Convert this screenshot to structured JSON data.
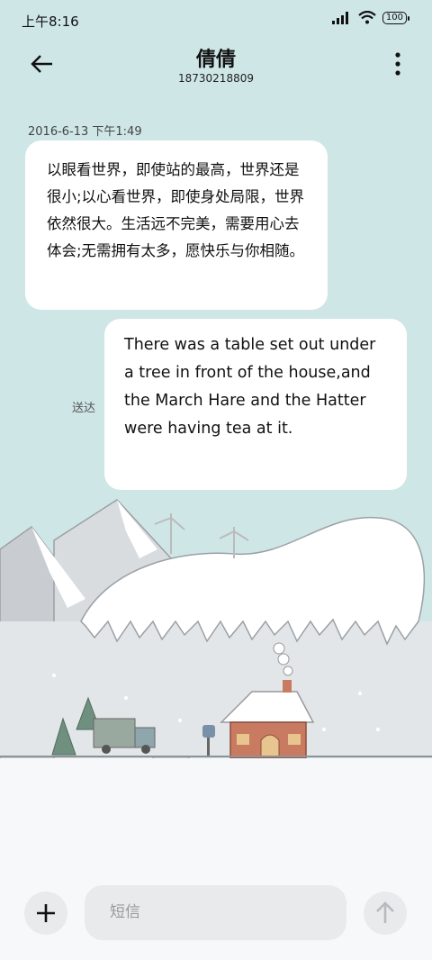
{
  "status_bar": {
    "time": "上午8:16",
    "battery": "100"
  },
  "header": {
    "contact_name": "倩倩",
    "phone_number": "18730218809"
  },
  "messages": [
    {
      "timestamp": "2016-6-13 下午1:49",
      "text": "以眼看世界，即使站的最高，世界还是很小;以心看世界，即使身处局限，世界依然很大。生活远不完美，需要用心去体会;无需拥有太多，愿快乐与你相随。"
    },
    {
      "text": "There was a table set out under a tree in front of the house,and the March Hare and the Hatter were having tea at it.",
      "status": "送达"
    }
  ],
  "composer": {
    "placeholder": "短信"
  },
  "colors": {
    "background": "#cfe6e7",
    "bubble": "#ffffff",
    "button": "#e9eaec"
  }
}
